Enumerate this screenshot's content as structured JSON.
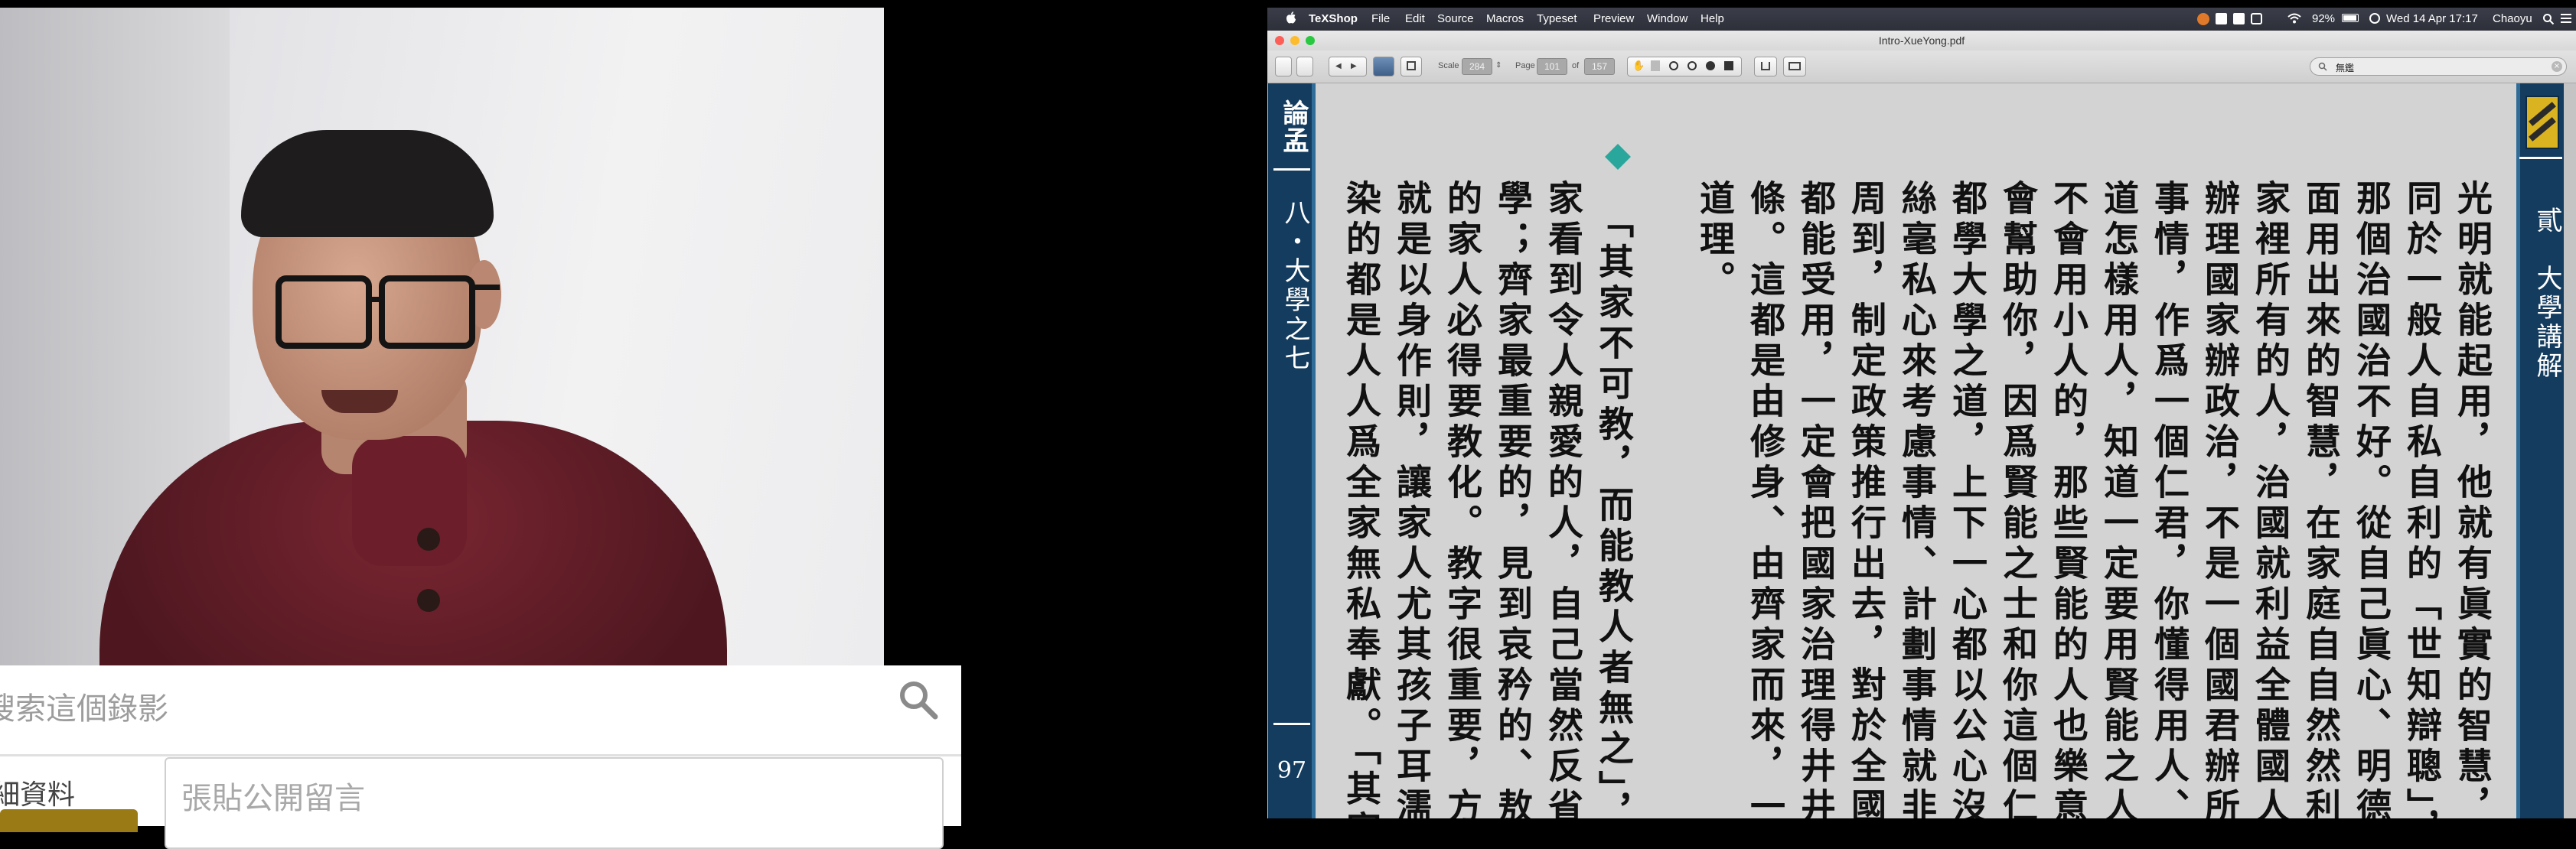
{
  "video": {
    "search_placeholder": "搜索這個錄影",
    "info_label": "細資料",
    "comment_placeholder": "張貼公開留言"
  },
  "menubar": {
    "app_name": "TeXShop",
    "menus": [
      "File",
      "Edit",
      "Source",
      "Macros",
      "Typeset",
      "Preview",
      "Window",
      "Help"
    ],
    "status": {
      "battery": "92%",
      "datetime": "Wed 14 Apr  17:17",
      "user": "Chaoyu"
    }
  },
  "window": {
    "title": "Intro-XueYong.pdf"
  },
  "toolbar": {
    "scale_label": "Scale",
    "scale_value": "284",
    "page_label": "Page",
    "page_value": "101",
    "of_label": "of",
    "page_total": "157",
    "search_text": "無鑑"
  },
  "pdf": {
    "left_band": {
      "heading": "論孟",
      "chapter": "八・大學之七",
      "page_number": "97"
    },
    "right_band": {
      "heading": "貳　大學講解"
    },
    "columns": [
      "光明就能起用，他就有眞實的智慧，不",
      "同於一般人自私自利的「世知辯聰」，",
      "那個治國治不好。從自己眞心、明德裡",
      "面用出來的智慧，在家庭自自然然利益",
      "家裡所有的人，治國就利益全體國人。",
      "辦理國家辦政治，不是一個國君辦所有",
      "事情，作爲一個仁君，你懂得用人、知",
      "道怎樣用人，知道一定要用賢能之人，",
      "不會用小人的，那些賢能的人也樂意",
      "會幫助你，因爲賢能之士和你這個仁君",
      "都學大學之道，上下一心都以公心沒有",
      "絲毫私心來考慮事情、計劃事情就非常",
      "周到，制定政策推行出去，對於全國人",
      "都能受用，一定會把國家治理得井井有",
      "條。這都是由修身、由齊家而來，一個",
      "道理。"
    ],
    "columns_para2": [
      "「其家不可教，而能教人者無之」，在",
      "家看到令人親愛的人，自己當然反省要",
      "學；齊家最重要的，見到哀矜的、敖惰",
      "的家人必得要教化。教字很重要，方法",
      "就是以身作則，讓家人尤其孩子耳濡目",
      "染的都是人人爲全家無私奉獻。「其家"
    ]
  },
  "colors": {
    "band_blue": "#143c5f",
    "band_line": "#2f6d98",
    "diamond_teal": "#2aa79c",
    "page_gray": "#d3d3d3"
  }
}
